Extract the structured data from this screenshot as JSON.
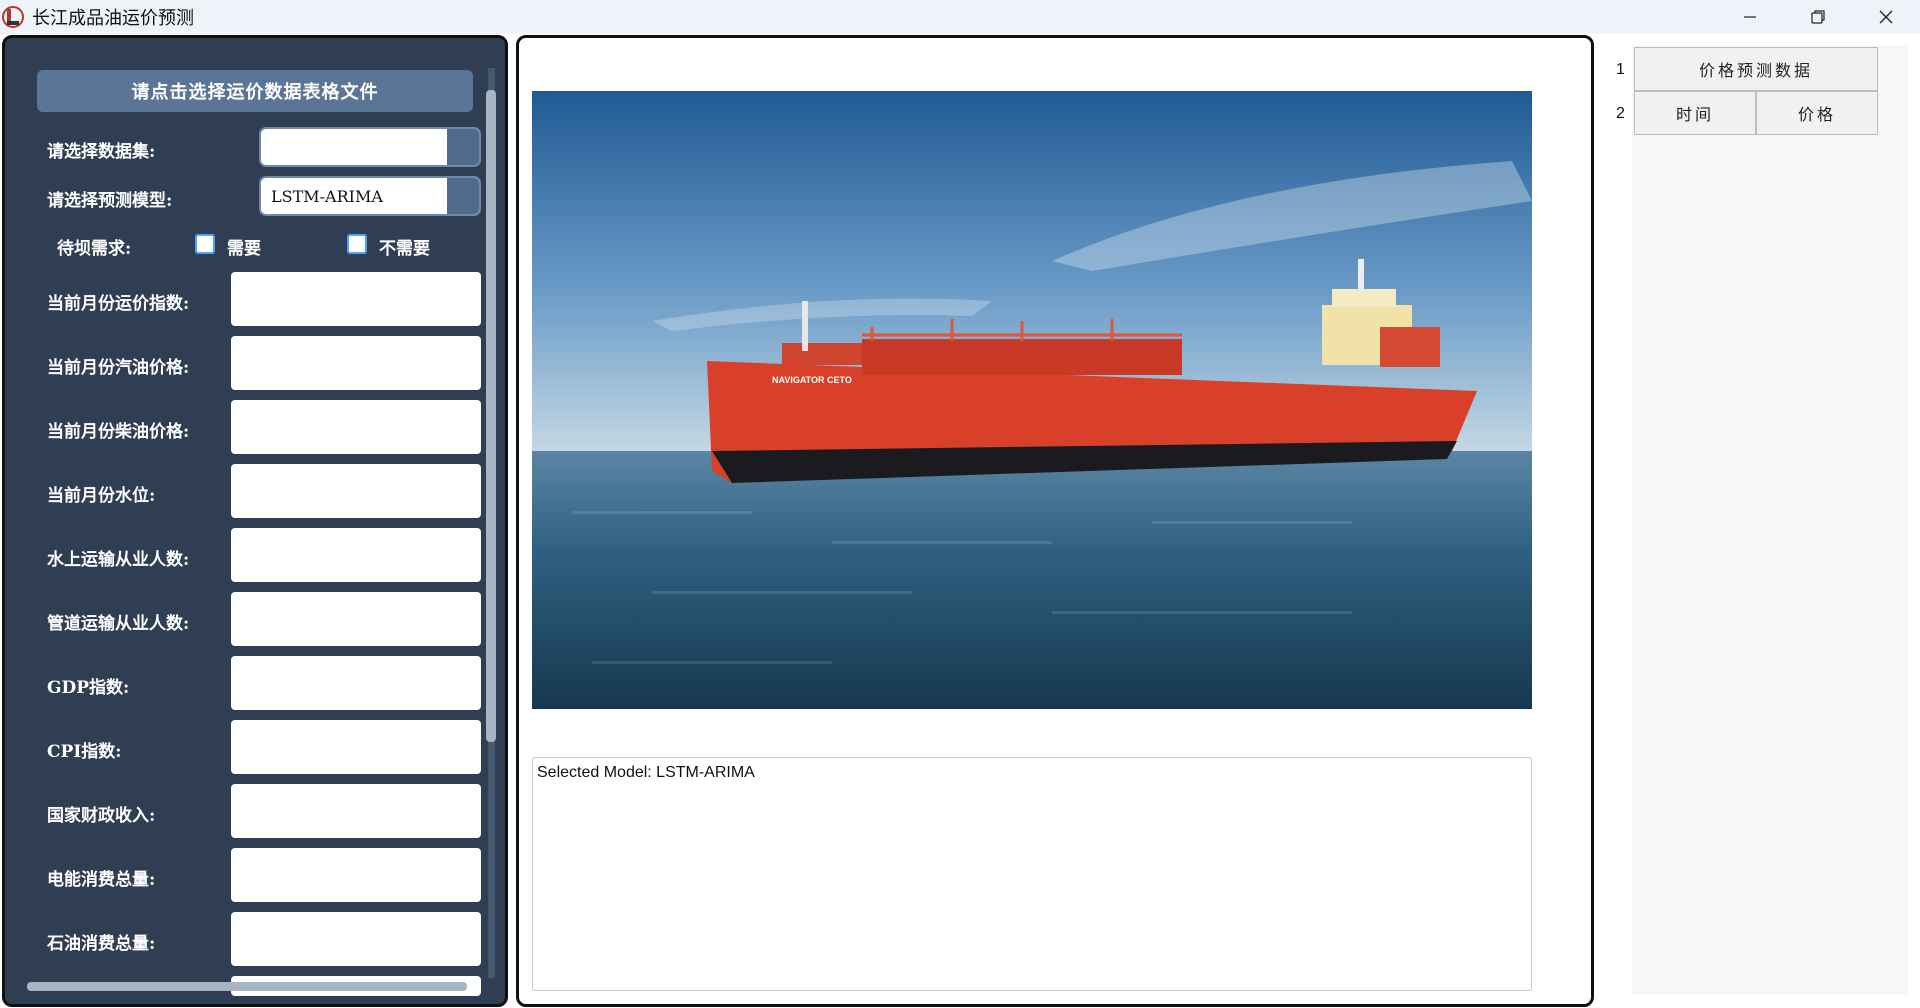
{
  "window": {
    "title": "长江成品油运价预测",
    "icon": "app-logo-icon"
  },
  "left_panel": {
    "select_file_button": "请点击选择运价数据表格文件",
    "dataset_label": "请选择数据集:",
    "dataset_value": "",
    "model_label": "请选择预测模型:",
    "model_value": "LSTM-ARIMA",
    "dam_label": "待坝需求:",
    "dam_options": [
      {
        "label": "需要",
        "checked": false
      },
      {
        "label": "不需要",
        "checked": false
      }
    ],
    "fields": [
      {
        "label": "当前月份运价指数:",
        "value": ""
      },
      {
        "label": "当前月份汽油价格:",
        "value": ""
      },
      {
        "label": "当前月份柴油价格:",
        "value": ""
      },
      {
        "label": "当前月份水位:",
        "value": ""
      },
      {
        "label": "水上运输从业人数:",
        "value": ""
      },
      {
        "label": "管道运输从业人数:",
        "value": ""
      },
      {
        "label": "GDP指数:",
        "value": ""
      },
      {
        "label": "CPI指数:",
        "value": ""
      },
      {
        "label": "国家财政收入:",
        "value": ""
      },
      {
        "label": "电能消费总量:",
        "value": ""
      },
      {
        "label": "石油消费总量:",
        "value": ""
      }
    ]
  },
  "center_panel": {
    "image": "oil-tanker-photo",
    "ship_name": "NAVIGATOR CETO",
    "output_text": "Selected Model: LSTM-ARIMA"
  },
  "table": {
    "row_numbers": [
      "1",
      "2"
    ],
    "header_title": "价格预测数据",
    "columns": [
      "时间",
      "价格"
    ]
  },
  "colors": {
    "left_panel_bg": "#2f3e52",
    "button_bg": "#5a7595",
    "checkbox_border": "#4aa3ff"
  }
}
